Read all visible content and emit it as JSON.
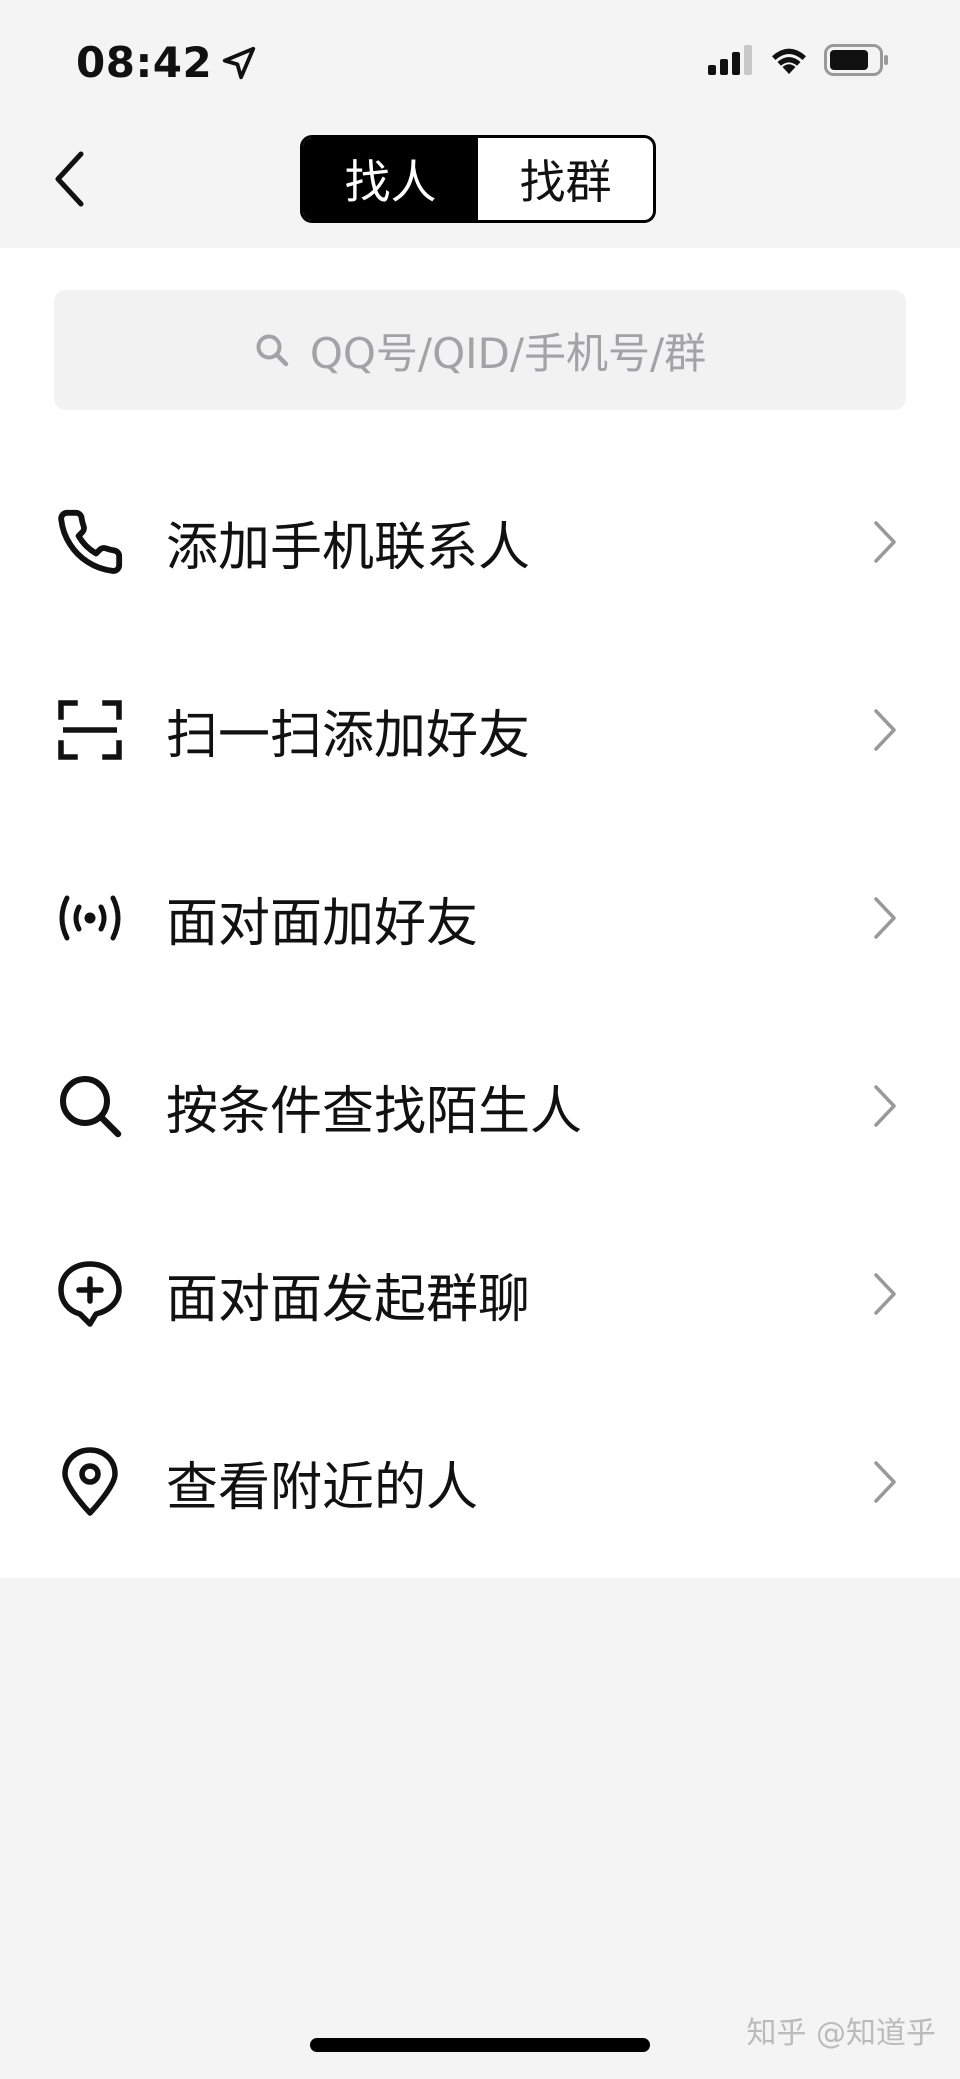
{
  "status_bar": {
    "time": "08:42"
  },
  "nav": {
    "tabs": [
      {
        "label": "找人",
        "active": true
      },
      {
        "label": "找群",
        "active": false
      }
    ]
  },
  "search": {
    "placeholder": "QQ号/QID/手机号/群"
  },
  "menu": [
    {
      "label": "添加手机联系人",
      "icon": "phone-icon"
    },
    {
      "label": "扫一扫添加好友",
      "icon": "scan-icon"
    },
    {
      "label": "面对面加好友",
      "icon": "broadcast-icon"
    },
    {
      "label": "按条件查找陌生人",
      "icon": "search-icon"
    },
    {
      "label": "面对面发起群聊",
      "icon": "chat-add-icon"
    },
    {
      "label": "查看附近的人",
      "icon": "location-pin-icon"
    }
  ],
  "watermark": "知乎 @知道乎",
  "colors": {
    "accent": "#000000",
    "placeholder": "#a3a3a6",
    "background": "#f4f4f5"
  }
}
